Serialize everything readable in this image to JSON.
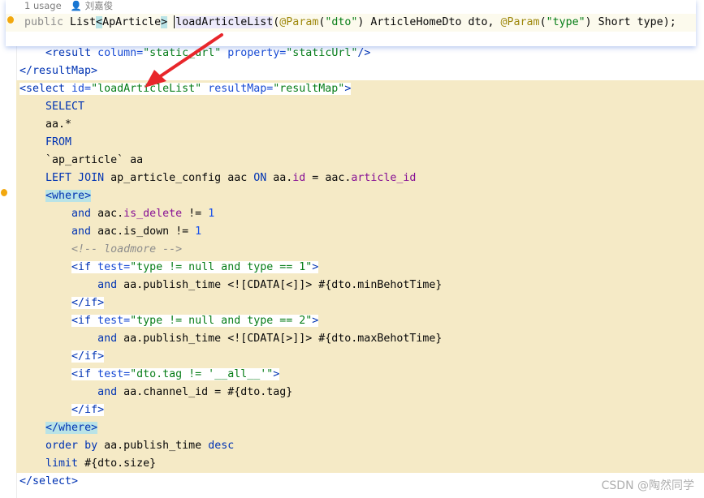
{
  "popup": {
    "usage": "1 usage",
    "author": "刘嘉俊",
    "signature": [
      [
        "public ",
        "g"
      ],
      [
        "List",
        "p"
      ],
      [
        "<",
        "p bg-m"
      ],
      [
        "ApArticle",
        "p"
      ],
      [
        ">",
        "p bg-m"
      ],
      [
        " ",
        "p"
      ],
      [
        "|",
        "caret"
      ],
      [
        "loadArticleList",
        "p ident"
      ],
      [
        "(",
        "p"
      ],
      [
        "@Param",
        "an"
      ],
      [
        "(",
        "p"
      ],
      [
        "\"dto\"",
        "v"
      ],
      [
        ") ArticleHomeDto dto, ",
        "p"
      ],
      [
        "@Param",
        "an"
      ],
      [
        "(",
        "p"
      ],
      [
        "\"type\"",
        "v"
      ],
      [
        ") Short type);",
        "p"
      ]
    ]
  },
  "lines": [
    {
      "indent": 1,
      "segs": [
        [
          "<",
          "t"
        ],
        [
          "result ",
          "t"
        ],
        [
          "column=",
          "a"
        ],
        [
          "\"static_url\" ",
          "v"
        ],
        [
          "property=",
          "a"
        ],
        [
          "\"staticUrl\"",
          "v"
        ],
        [
          "/>",
          "t"
        ]
      ]
    },
    {
      "indent": 0,
      "segs": [
        [
          "</resultMap>",
          "t"
        ]
      ]
    },
    {
      "indent": 0,
      "tag": true,
      "segs": [
        [
          "<select ",
          "t"
        ],
        [
          "id=",
          "a"
        ],
        [
          "\"loadArticleList\" ",
          "v"
        ],
        [
          "resultMap=",
          "a"
        ],
        [
          "\"resultMap\"",
          "v"
        ],
        [
          ">",
          "t"
        ]
      ]
    },
    {
      "indent": 1,
      "segs": [
        [
          "SELECT",
          "kw"
        ]
      ]
    },
    {
      "indent": 1,
      "segs": [
        [
          "aa.*",
          "p"
        ]
      ]
    },
    {
      "indent": 1,
      "segs": [
        [
          "FROM",
          "kw"
        ]
      ]
    },
    {
      "indent": 1,
      "segs": [
        [
          "`ap_article` aa",
          "p"
        ]
      ]
    },
    {
      "indent": 1,
      "segs": [
        [
          "LEFT JOIN ",
          "kw"
        ],
        [
          "ap_article_config aac ",
          "p"
        ],
        [
          "ON ",
          "kw"
        ],
        [
          "aa.",
          "p"
        ],
        [
          "id",
          "c"
        ],
        [
          " = aac.",
          "p"
        ],
        [
          "article_id",
          "c"
        ]
      ]
    },
    {
      "indent": 1,
      "match": true,
      "segs": [
        [
          "<where>",
          "t"
        ]
      ]
    },
    {
      "indent": 2,
      "segs": [
        [
          "and ",
          "kw"
        ],
        [
          "aac.",
          "p"
        ],
        [
          "is_delete",
          "c"
        ],
        [
          " != ",
          "p"
        ],
        [
          "1",
          "n"
        ]
      ]
    },
    {
      "indent": 2,
      "segs": [
        [
          "and ",
          "kw"
        ],
        [
          "aac.is_down != ",
          "p"
        ],
        [
          "1",
          "n"
        ]
      ]
    },
    {
      "indent": 2,
      "segs": [
        [
          "<!-- loadmore -->",
          "cm"
        ]
      ]
    },
    {
      "indent": 2,
      "tag": true,
      "segs": [
        [
          "<if ",
          "t"
        ],
        [
          "test=",
          "a"
        ],
        [
          "\"type != null and type == 1\"",
          "v"
        ],
        [
          ">",
          "t"
        ]
      ]
    },
    {
      "indent": 3,
      "segs": [
        [
          "and ",
          "kw"
        ],
        [
          "aa.publish_time <![CDATA[<]]> #{dto.minBehotTime}",
          "p"
        ]
      ]
    },
    {
      "indent": 2,
      "tag": true,
      "segs": [
        [
          "</if>",
          "t"
        ]
      ]
    },
    {
      "indent": 2,
      "tag": true,
      "segs": [
        [
          "<if ",
          "t"
        ],
        [
          "test=",
          "a"
        ],
        [
          "\"type != null and type == 2\"",
          "v"
        ],
        [
          ">",
          "t"
        ]
      ]
    },
    {
      "indent": 3,
      "segs": [
        [
          "and ",
          "kw"
        ],
        [
          "aa.publish_time <![CDATA[>]]> #{dto.maxBehotTime}",
          "p"
        ]
      ]
    },
    {
      "indent": 2,
      "tag": true,
      "segs": [
        [
          "</if>",
          "t"
        ]
      ]
    },
    {
      "indent": 2,
      "tag": true,
      "segs": [
        [
          "<if ",
          "t"
        ],
        [
          "test=",
          "a"
        ],
        [
          "\"dto.tag != '__all__'\"",
          "v"
        ],
        [
          ">",
          "t"
        ]
      ]
    },
    {
      "indent": 3,
      "segs": [
        [
          "and ",
          "kw"
        ],
        [
          "aa.channel_id = #{dto.tag}",
          "p"
        ]
      ]
    },
    {
      "indent": 2,
      "tag": true,
      "segs": [
        [
          "</if>",
          "t"
        ]
      ]
    },
    {
      "indent": 1,
      "match": true,
      "segs": [
        [
          "</where>",
          "t"
        ]
      ]
    },
    {
      "indent": 1,
      "segs": [
        [
          "order by ",
          "kw"
        ],
        [
          "aa.publish_time ",
          "p"
        ],
        [
          "desc",
          "kw"
        ]
      ]
    },
    {
      "indent": 1,
      "segs": [
        [
          "limit ",
          "kw"
        ],
        [
          "#{dto.size}",
          "p"
        ]
      ]
    },
    {
      "indent": 0,
      "tag": true,
      "segs": [
        [
          "</select>",
          "t"
        ]
      ]
    }
  ],
  "watermark": "CSDN @陶然同学",
  "colors": {
    "highlight_bg": "#f5eac6",
    "arrow": "#e8262b",
    "tag": "#0033b3",
    "string": "#067d17"
  }
}
